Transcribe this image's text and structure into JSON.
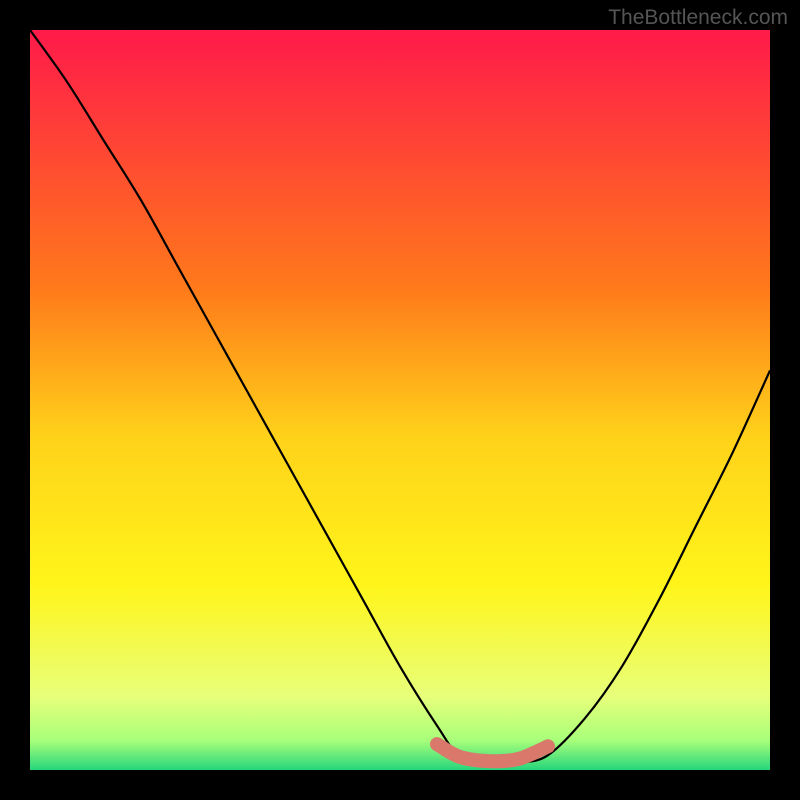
{
  "watermark": "TheBottleneck.com",
  "chart_data": {
    "type": "line",
    "title": "",
    "xlabel": "",
    "ylabel": "",
    "xlim": [
      0,
      100
    ],
    "ylim": [
      0,
      100
    ],
    "series": [
      {
        "name": "bottleneck-curve",
        "x": [
          0,
          5,
          10,
          15,
          20,
          25,
          30,
          35,
          40,
          45,
          50,
          55,
          58,
          62,
          66,
          70,
          75,
          80,
          85,
          90,
          95,
          100
        ],
        "y": [
          100,
          93,
          85,
          77,
          68,
          59,
          50,
          41,
          32,
          23,
          14,
          6,
          2,
          1,
          1,
          2,
          7,
          14,
          23,
          33,
          43,
          54
        ]
      }
    ],
    "highlight_band": {
      "name": "optimal-range",
      "x": [
        55,
        58,
        62,
        66,
        70
      ],
      "y": [
        3.5,
        1.8,
        1.2,
        1.5,
        3.2
      ]
    },
    "gradient_stops": [
      {
        "offset": 0,
        "color": "#ff1a4a"
      },
      {
        "offset": 35,
        "color": "#ff7a1a"
      },
      {
        "offset": 55,
        "color": "#ffd21a"
      },
      {
        "offset": 75,
        "color": "#fff51a"
      },
      {
        "offset": 90,
        "color": "#e8ff7a"
      },
      {
        "offset": 96,
        "color": "#a8ff7a"
      },
      {
        "offset": 100,
        "color": "#26d67c"
      }
    ]
  }
}
